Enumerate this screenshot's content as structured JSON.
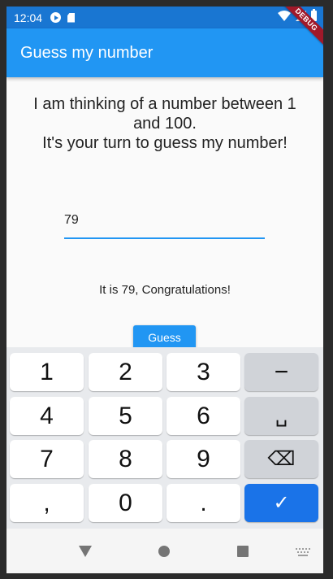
{
  "status_bar": {
    "time": "12:04",
    "icons": [
      "play-icon",
      "sd-card-icon",
      "wifi-icon",
      "signal-icon",
      "battery-icon"
    ]
  },
  "debug_banner": "DEBUG",
  "app_bar": {
    "title": "Guess my number"
  },
  "content": {
    "prompt_line1": "I am thinking of a number between 1",
    "prompt_line2": "and 100.",
    "prompt_line3": "It's your turn to guess my number!",
    "input_value": "79",
    "result_text": "It is 79, Congratulations!",
    "guess_button_label": "Guess"
  },
  "keyboard": {
    "rows": [
      [
        "1",
        "2",
        "3",
        "−"
      ],
      [
        "4",
        "5",
        "6",
        "␣"
      ],
      [
        "7",
        "8",
        "9",
        "⌫"
      ],
      [
        ",",
        "0",
        ".",
        "✓"
      ]
    ]
  },
  "colors": {
    "status_bar": "#1976d2",
    "app_bar": "#2196f3",
    "accent": "#2196f3",
    "keyboard_action": "#1a73e8"
  },
  "nav_bar": {
    "icons": [
      "back-icon",
      "home-icon",
      "recents-icon",
      "keyboard-switch-icon"
    ]
  }
}
